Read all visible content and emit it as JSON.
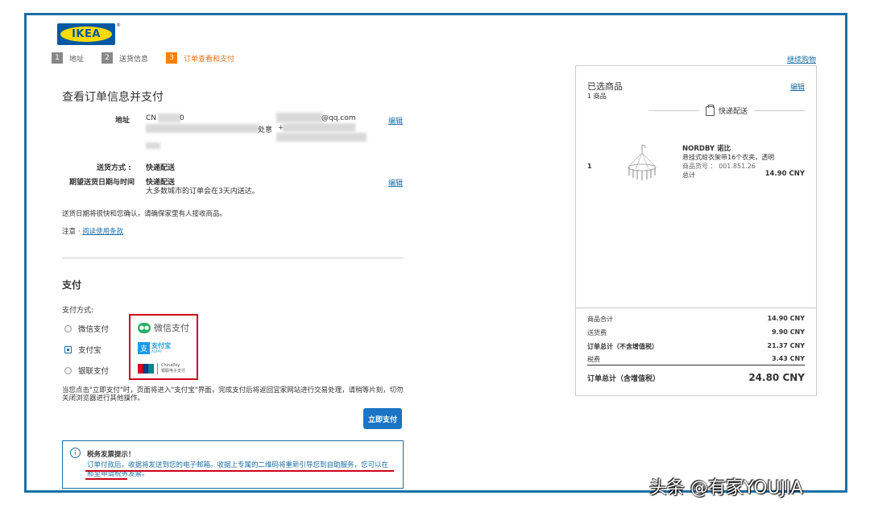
{
  "brand": {
    "logo_text": "IKEA",
    "registered": "®"
  },
  "steps": [
    {
      "num": "1",
      "label": "地址"
    },
    {
      "num": "2",
      "label": "送货信息"
    },
    {
      "num": "3",
      "label": "订单查看和支付"
    }
  ],
  "continue_shopping": "继续购物",
  "order": {
    "title": "查看订单信息并支付",
    "address_label": "地址",
    "address_prefix": "CN",
    "address_suffix": "0",
    "email_suffix": "@qq.com",
    "address_place": "处意",
    "address_plus": "+",
    "edit_label": "编辑",
    "ship_method_label": "送货方式 :",
    "ship_method_value": "快递配送",
    "date_label": "期望送货日期与时间",
    "date_value": "快递配送",
    "date_note": "大多数城市的订单会在3天内送达。",
    "notice": "送货日期将很快和您确认，请确保家里有人接收商品。",
    "terms_prefix": "注意 · ",
    "terms_link": "阅读使用条款"
  },
  "payment": {
    "title": "支付",
    "method_label": "支付方式:",
    "options": [
      {
        "label": "微信支付",
        "selected": false
      },
      {
        "label": "支付宝",
        "selected": true
      },
      {
        "label": "银联支付",
        "selected": false
      }
    ],
    "wechat_logo": "微信支付",
    "alipay_logo_cn": "支付宝",
    "alipay_logo_en": "ALIPAY",
    "unionpay_logo_en": "ChinaPay",
    "unionpay_logo_cn": "银联电子支付",
    "note": "当您点击\"立即支付\"时，页面将进入\"支付宝\"界面，完成支付后将返回宜家网站进行交易处理，请稍等片刻，切勿关闭浏览器进行其他操作。",
    "pay_button": "立即支付"
  },
  "tax": {
    "title": "税务发票提示！",
    "body": "订单付款后，收据将发送到您的电子邮箱。收据上专属的二维码将重新引导您到自助服务，您可以在那里申请税务发票。",
    "info_icon": "i"
  },
  "cart": {
    "title": "已选商品",
    "count": "1 商品",
    "edit": "编辑",
    "shipping": "快递配送",
    "item": {
      "qty": "1",
      "name": "NORDBY 诺比",
      "desc": "悬挂式晾衣架带16个衣夹，透明",
      "number": "商品货号 ： 001.851.26",
      "total_label": "总计",
      "total_value": "14.90 CNY"
    },
    "summary": [
      {
        "label": "商品合计",
        "value": "14.90 CNY"
      },
      {
        "label": "送货费",
        "value": "9.90 CNY"
      },
      {
        "label": "订单总计（不含增值税）",
        "value": "21.37 CNY"
      },
      {
        "label": "税费",
        "value": "3.43 CNY"
      }
    ],
    "grand_label": "订单总计（含增值税）",
    "grand_value": "24.80 CNY"
  },
  "watermark": "头条 @有家YOUJIA",
  "colors": {
    "accent": "#1b6fa6",
    "step_active": "#ff7f00",
    "highlight": "#d0021b",
    "pay_button": "#1b74c4"
  }
}
